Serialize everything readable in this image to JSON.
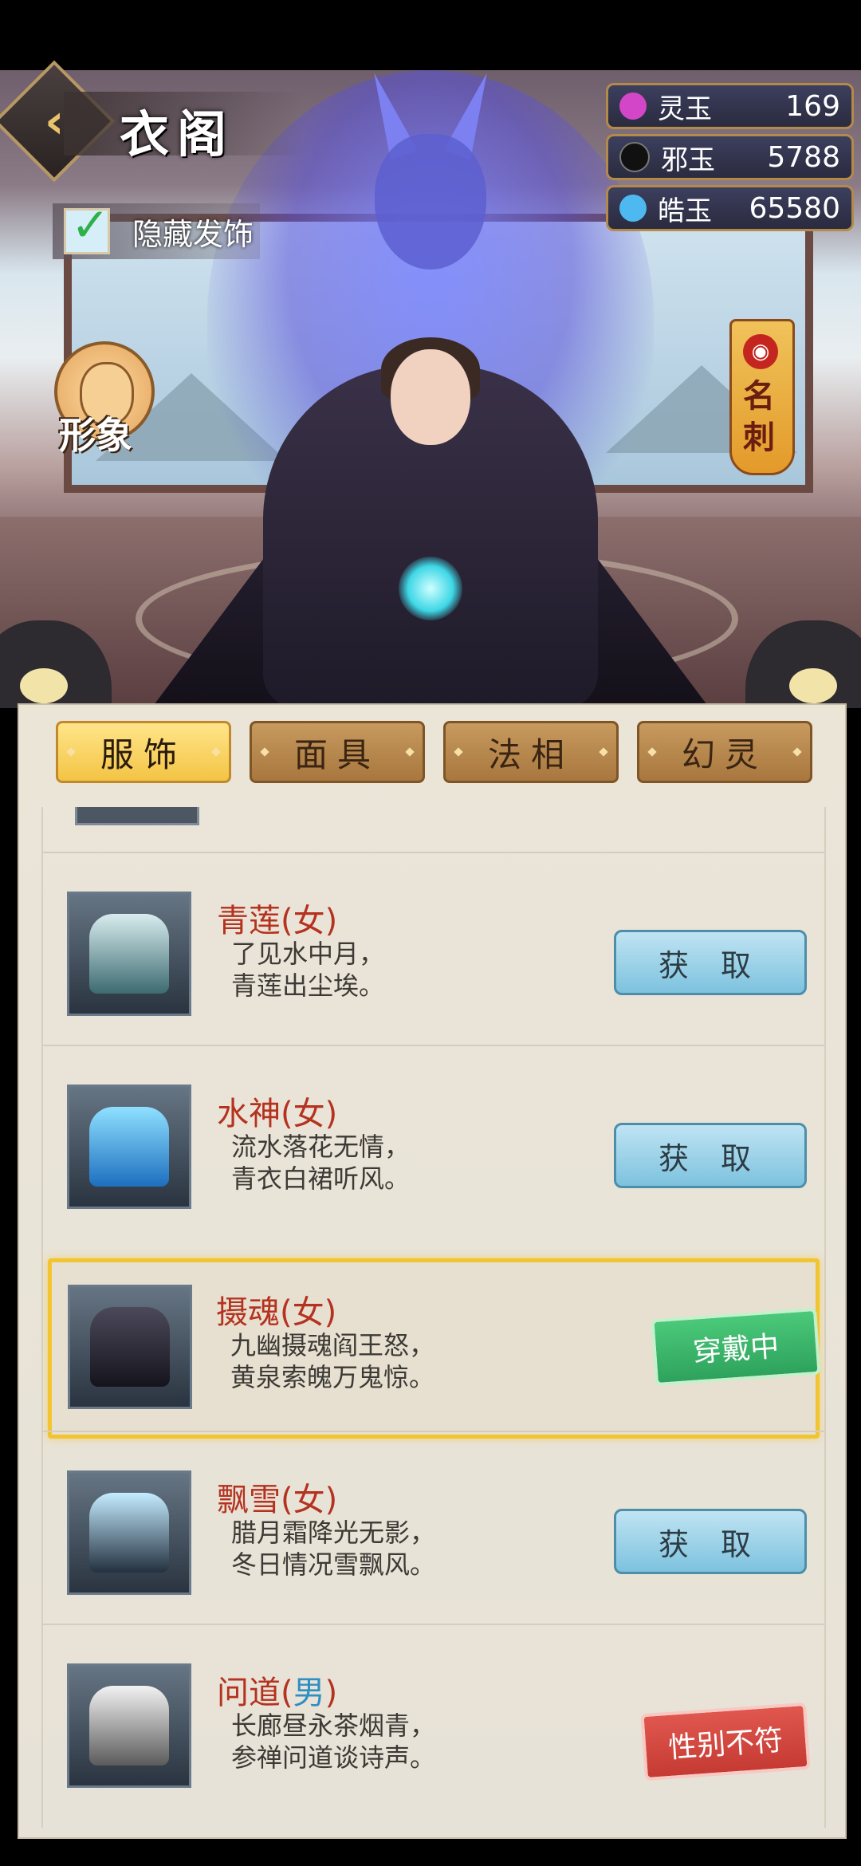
{
  "header": {
    "title": "衣阁",
    "hide_accessory_label": "隐藏发饰",
    "hide_accessory_checked": true
  },
  "side": {
    "avatar_label": "形象",
    "name_card_label": "名刺"
  },
  "currencies": [
    {
      "name": "灵玉",
      "value": "169",
      "color": "#d346c8"
    },
    {
      "name": "邪玉",
      "value": "5788",
      "color": "#2a2a2a"
    },
    {
      "name": "皓玉",
      "value": "65580",
      "color": "#4db9f0"
    }
  ],
  "tabs": [
    {
      "label": "服饰",
      "active": true
    },
    {
      "label": "面具",
      "active": false
    },
    {
      "label": "法相",
      "active": false
    },
    {
      "label": "幻灵",
      "active": false
    }
  ],
  "items": [
    {
      "name": "青莲",
      "gender": "女",
      "line1": "了见水中月，",
      "line2": "青莲出尘埃。",
      "action": "获 取",
      "action_type": "get"
    },
    {
      "name": "水神",
      "gender": "女",
      "line1": "流水落花无情，",
      "line2": "青衣白裙听风。",
      "action": "获 取",
      "action_type": "get"
    },
    {
      "name": "摄魂",
      "gender": "女",
      "line1": "九幽摄魂阎王怒，",
      "line2": "黄泉索魄万鬼惊。",
      "action": "穿戴中",
      "action_type": "wearing"
    },
    {
      "name": "飘雪",
      "gender": "女",
      "line1": "腊月霜降光无影，",
      "line2": "冬日情况雪飘风。",
      "action": "获 取",
      "action_type": "get"
    },
    {
      "name": "问道",
      "gender": "男",
      "line1": "长廊昼永茶烟青，",
      "line2": "参禅问道谈诗声。",
      "action": "性别不符",
      "action_type": "gender_mismatch"
    }
  ]
}
